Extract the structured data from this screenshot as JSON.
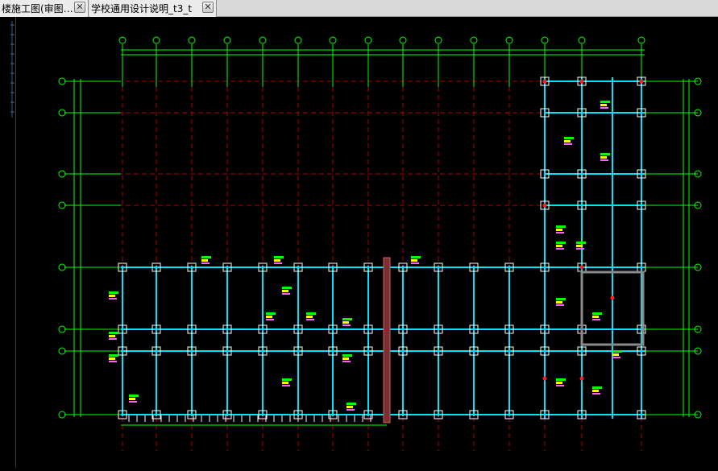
{
  "tabs": [
    {
      "label": "楼施工图(审图…",
      "close_icon": "close-icon",
      "active": true
    },
    {
      "label": "学校通用设计说明_t3_t",
      "close_icon": "close-icon",
      "active": false
    }
  ],
  "drawing": {
    "type": "cad-structural-floor-plan",
    "background": "#000000",
    "colors": {
      "grid_line": "#00ff00",
      "axis_line": "#b00000",
      "beam": "#00e5ff",
      "column": "#ffffff",
      "annotation": "#00ff00",
      "highlight": "#ffff00",
      "text_dim": "#ffffff"
    }
  }
}
